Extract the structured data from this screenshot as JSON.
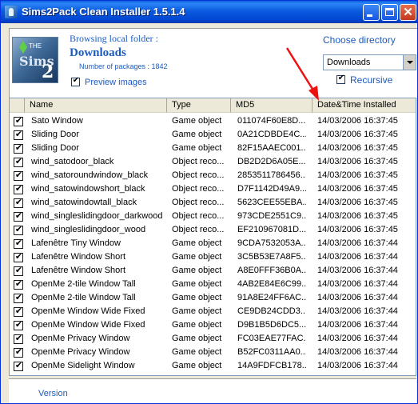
{
  "window": {
    "title": "Sims2Pack Clean Installer 1.5.1.4",
    "minimize_icon": "minimize-icon",
    "maximize_icon": "maximize-icon",
    "close_icon": "close-icon",
    "close_glyph": "✕"
  },
  "header": {
    "browsing_label": "Browsing local folder :",
    "folder_name": "Downloads",
    "package_count_label": "Number of packages : 1842",
    "preview_images_label": "Preview images",
    "preview_images_checked": true,
    "choose_directory_label": "Choose directory",
    "directory_selected": "Downloads",
    "recursive_label": "Recursive",
    "recursive_checked": true
  },
  "list": {
    "columns": [
      "Name",
      "Type",
      "MD5",
      "Date&Time Installed"
    ],
    "checkmark": "✔",
    "rows": [
      {
        "checked": true,
        "name": "Sato Window",
        "type": "Game object",
        "md5": "011074F60E8D...",
        "date": "14/03/2006 16:37:45"
      },
      {
        "checked": true,
        "name": "Sliding Door",
        "type": "Game object",
        "md5": "0A21CDBDE4C...",
        "date": "14/03/2006 16:37:45"
      },
      {
        "checked": true,
        "name": "Sliding Door",
        "type": "Game object",
        "md5": "82F15AAEC001...",
        "date": "14/03/2006 16:37:45"
      },
      {
        "checked": true,
        "name": "wind_satodoor_black",
        "type": "Object reco...",
        "md5": "DB2D2D6A05E...",
        "date": "14/03/2006 16:37:45"
      },
      {
        "checked": true,
        "name": "wind_satoroundwindow_black",
        "type": "Object reco...",
        "md5": "2853511786456...",
        "date": "14/03/2006 16:37:45"
      },
      {
        "checked": true,
        "name": "wind_satowindowshort_black",
        "type": "Object reco...",
        "md5": "D7F1142D49A9...",
        "date": "14/03/2006 16:37:45"
      },
      {
        "checked": true,
        "name": "wind_satowindowtall_black",
        "type": "Object reco...",
        "md5": "5623CEE55EBA...",
        "date": "14/03/2006 16:37:45"
      },
      {
        "checked": true,
        "name": "wind_singleslidingdoor_darkwood",
        "type": "Object reco...",
        "md5": "973CDE2551C9...",
        "date": "14/03/2006 16:37:45"
      },
      {
        "checked": true,
        "name": "wind_singleslidingdoor_wood",
        "type": "Object reco...",
        "md5": "EF210967081D...",
        "date": "14/03/2006 16:37:45"
      },
      {
        "checked": true,
        "name": "Lafenêtre Tiny Window",
        "type": "Game object",
        "md5": "9CDA7532053A...",
        "date": "14/03/2006 16:37:44"
      },
      {
        "checked": true,
        "name": "Lafenêtre Window Short",
        "type": "Game object",
        "md5": "3C5B53E7A8F5...",
        "date": "14/03/2006 16:37:44"
      },
      {
        "checked": true,
        "name": "Lafenêtre Window Short",
        "type": "Game object",
        "md5": "A8E0FFF36B0A...",
        "date": "14/03/2006 16:37:44"
      },
      {
        "checked": true,
        "name": "OpenMe 2-tile Window Tall",
        "type": "Game object",
        "md5": "4AB2E84E6C99...",
        "date": "14/03/2006 16:37:44"
      },
      {
        "checked": true,
        "name": "OpenMe 2-tile Window Tall",
        "type": "Game object",
        "md5": "91A8E24FF6AC...",
        "date": "14/03/2006 16:37:44"
      },
      {
        "checked": true,
        "name": "OpenMe Window Wide Fixed",
        "type": "Game object",
        "md5": "CE9DB24CDD3...",
        "date": "14/03/2006 16:37:44"
      },
      {
        "checked": true,
        "name": "OpenMe Window Wide Fixed",
        "type": "Game object",
        "md5": "D9B1B5D6DC5...",
        "date": "14/03/2006 16:37:44"
      },
      {
        "checked": true,
        "name": "OpenMe Privacy Window",
        "type": "Game object",
        "md5": "FC03EAE77FAC...",
        "date": "14/03/2006 16:37:44"
      },
      {
        "checked": true,
        "name": "OpenMe Privacy Window",
        "type": "Game object",
        "md5": "B52FC0311AA0...",
        "date": "14/03/2006 16:37:44"
      },
      {
        "checked": true,
        "name": "OpenMe Sidelight Window",
        "type": "Game object",
        "md5": "14A9FDFCB178...",
        "date": "14/03/2006 16:37:44"
      }
    ]
  },
  "footer": {
    "version_label": "Version"
  },
  "annotation": {
    "icon": "red-arrow-icon",
    "color": "#ee1111"
  },
  "logo": {
    "icon": "sims2-logo-icon",
    "text_the": "THE",
    "text_sims": "Sims",
    "text_two": "2"
  }
}
